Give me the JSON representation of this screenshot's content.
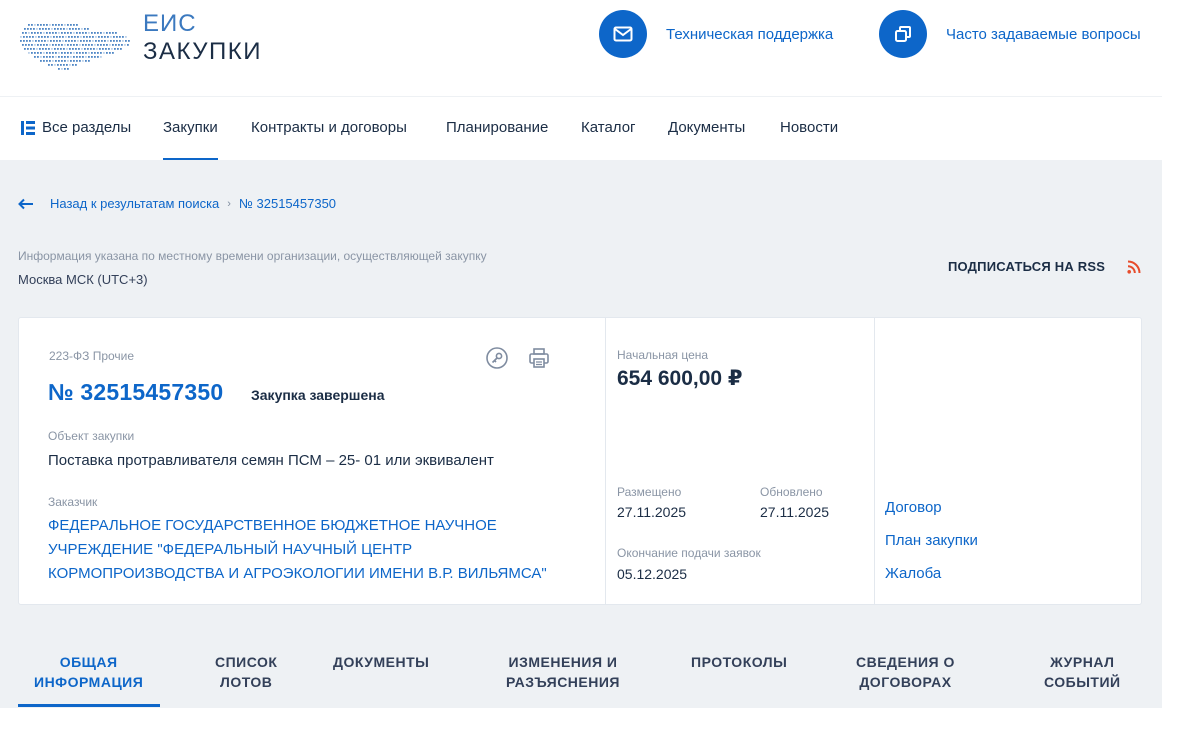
{
  "header": {
    "logo_line1": "ЕИС",
    "logo_line2": "ЗАКУПКИ",
    "support": {
      "label": "Техническая поддержка",
      "icon": "mail-icon"
    },
    "faq": {
      "label": "Часто задаваемые вопросы",
      "icon": "windows-icon"
    }
  },
  "nav": {
    "all_sections": "Все разделы",
    "items": [
      "Закупки",
      "Контракты и договоры",
      "Планирование",
      "Каталог",
      "Документы",
      "Новости"
    ],
    "active": "Закупки"
  },
  "breadcrumb": {
    "back": "Назад к результатам поиска",
    "separator": "›",
    "current": "№ 32515457350"
  },
  "timezone": {
    "note": "Информация указана по местному времени организации, осуществляющей закупку",
    "value": "Москва МСК (UTC+3)"
  },
  "rss": {
    "label": "ПОДПИСАТЬСЯ НА RSS",
    "icon": "rss-icon"
  },
  "card": {
    "law": "223-ФЗ Прочие",
    "number": "№ 32515457350",
    "status": "Закупка завершена",
    "object_label": "Объект закупки",
    "object_value": "Поставка протравливателя семян ПСМ – 25- 01 или эквивалент",
    "customer_label": "Заказчик",
    "customer_value": "ФЕДЕРАЛЬНОЕ ГОСУДАРСТВЕННОЕ БЮДЖЕТНОЕ НАУЧНОЕ УЧРЕЖДЕНИЕ \"ФЕДЕРАЛЬНЫЙ НАУЧНЫЙ ЦЕНТР КОРМОПРОИЗВОДСТВА И АГРОЭКОЛОГИИ ИМЕНИ В.Р. ВИЛЬЯМСА\"",
    "price_label": "Начальная цена",
    "price_value": "654 600,00 ₽",
    "posted_label": "Размещено",
    "posted_value": "27.11.2025",
    "updated_label": "Обновлено",
    "updated_value": "27.11.2025",
    "deadline_label": "Окончание подачи заявок",
    "deadline_value": "05.12.2025",
    "links": [
      "Договор",
      "План закупки",
      "Жалоба"
    ]
  },
  "tabs": [
    {
      "line1": "ОБЩАЯ",
      "line2": "ИНФОРМАЦИЯ"
    },
    {
      "line1": "СПИСОК",
      "line2": "ЛОТОВ"
    },
    {
      "line1": "ДОКУМЕНТЫ",
      "line2": ""
    },
    {
      "line1": "ИЗМЕНЕНИЯ И",
      "line2": "РАЗЪЯСНЕНИЯ"
    },
    {
      "line1": "ПРОТОКОЛЫ",
      "line2": ""
    },
    {
      "line1": "СВЕДЕНИЯ О",
      "line2": "ДОГОВОРАХ"
    },
    {
      "line1": "ЖУРНАЛ",
      "line2": "СОБЫТИЙ"
    }
  ],
  "active_tab": "ОБЩАЯ ИНФОРМАЦИЯ",
  "colors": {
    "accent": "#0d66c9",
    "background_grey": "#eef1f4",
    "text_dark": "#1b2d45",
    "rss": "#e74c2b"
  }
}
